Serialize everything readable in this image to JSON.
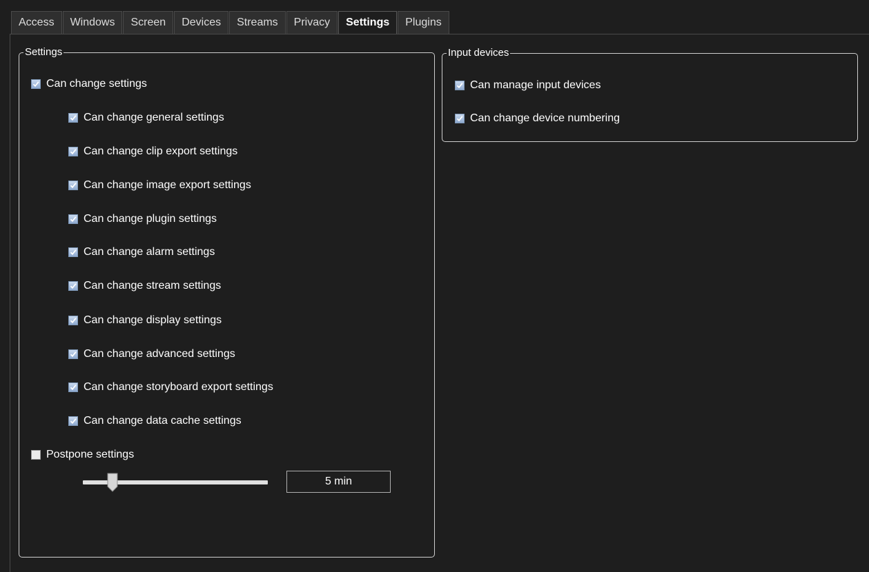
{
  "tabs": [
    {
      "label": "Access"
    },
    {
      "label": "Windows"
    },
    {
      "label": "Screen"
    },
    {
      "label": "Devices"
    },
    {
      "label": "Streams"
    },
    {
      "label": "Privacy"
    },
    {
      "label": "Settings",
      "active": true
    },
    {
      "label": "Plugins"
    }
  ],
  "settings_group": {
    "title": "Settings",
    "main": {
      "label": "Can change settings",
      "checked": true
    },
    "items": [
      {
        "label": "Can change general settings",
        "checked": true
      },
      {
        "label": "Can change clip export settings",
        "checked": true
      },
      {
        "label": "Can change image export settings",
        "checked": true
      },
      {
        "label": "Can change plugin settings",
        "checked": true
      },
      {
        "label": "Can change alarm settings",
        "checked": true
      },
      {
        "label": "Can change stream settings",
        "checked": true
      },
      {
        "label": "Can change display settings",
        "checked": true
      },
      {
        "label": "Can change advanced settings",
        "checked": true
      },
      {
        "label": "Can change storyboard export settings",
        "checked": true
      },
      {
        "label": "Can change data cache settings",
        "checked": true
      }
    ],
    "postpone": {
      "label": "Postpone settings",
      "checked": false
    },
    "slider_value_fraction": 0.14,
    "postpone_value": "5 min"
  },
  "input_group": {
    "title": "Input devices",
    "items": [
      {
        "label": "Can manage input devices",
        "checked": true
      },
      {
        "label": "Can change device numbering",
        "checked": true
      }
    ]
  },
  "colors": {
    "background": "#1e1e1e",
    "checkbox_fill": "#8ea9cf",
    "border": "#cfcfcf"
  }
}
